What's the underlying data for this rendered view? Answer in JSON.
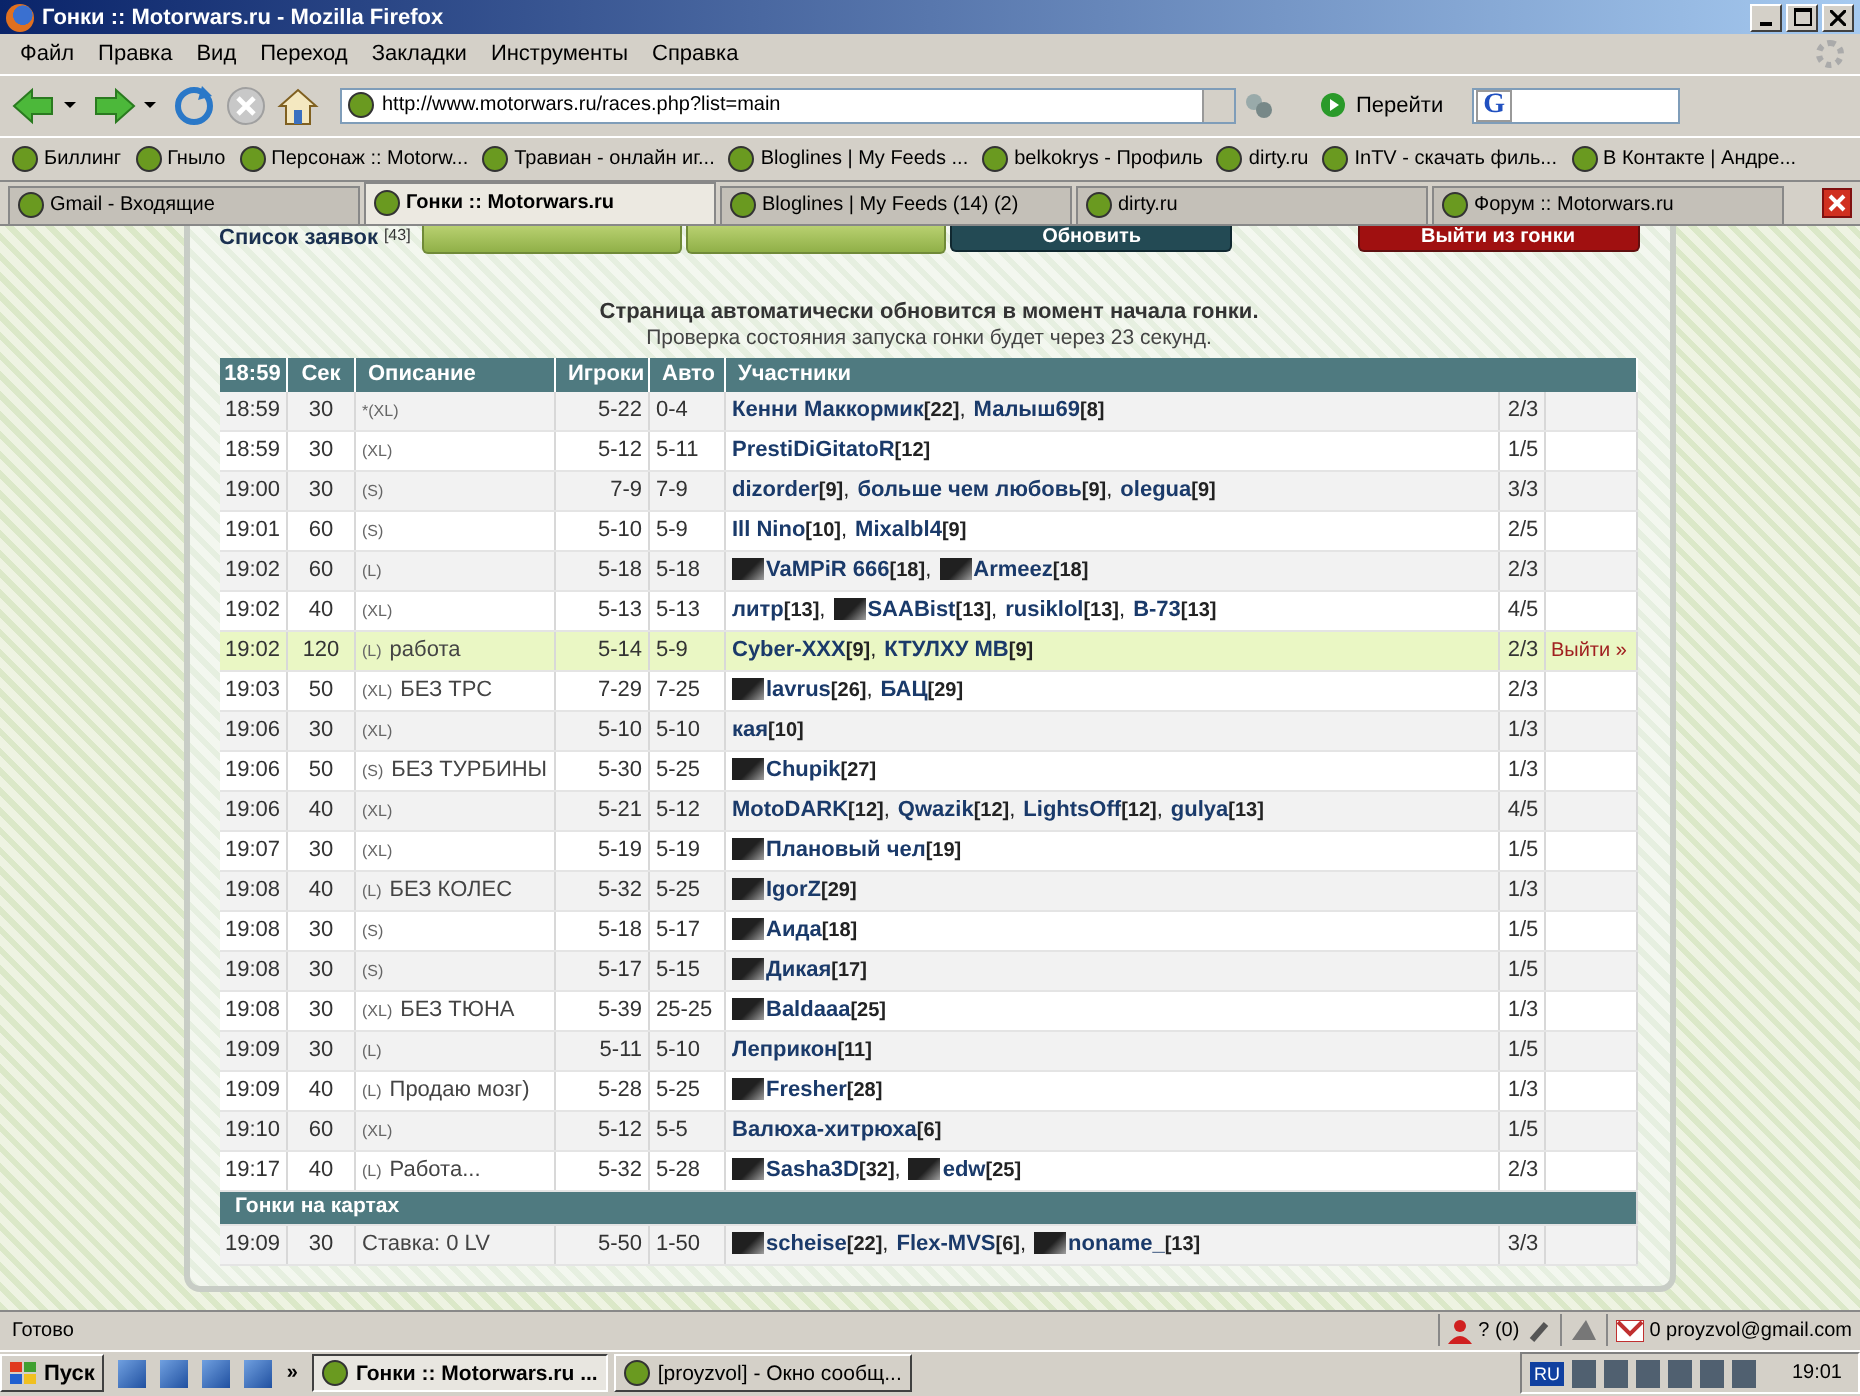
{
  "window": {
    "title": "Гонки :: Motorwars.ru - Mozilla Firefox"
  },
  "menu": [
    "Файл",
    "Правка",
    "Вид",
    "Переход",
    "Закладки",
    "Инструменты",
    "Справка"
  ],
  "address": {
    "value": "http://www.motorwars.ru/races.php?list=main"
  },
  "go_button": "Перейти",
  "search": {
    "engine_label": "G"
  },
  "bookmarks": [
    {
      "label": "Биллинг"
    },
    {
      "label": "Гныло"
    },
    {
      "label": "Персонаж :: Motorw..."
    },
    {
      "label": "Травиан - онлайн иг..."
    },
    {
      "label": "Bloglines | My Feeds ..."
    },
    {
      "label": "belkokrys - Профиль"
    },
    {
      "label": "dirty.ru"
    },
    {
      "label": "InTV - скачать филь..."
    },
    {
      "label": "В Контакте | Андре..."
    }
  ],
  "tabs": [
    {
      "label": "Gmail - Входящие",
      "selected": false
    },
    {
      "label": "Гонки :: Motorwars.ru",
      "selected": true
    },
    {
      "label": "Bloglines | My Feeds (14) (2)",
      "selected": false
    },
    {
      "label": "dirty.ru",
      "selected": false
    },
    {
      "label": "Форум :: Motorwars.ru",
      "selected": false
    }
  ],
  "page": {
    "list_title": "Список заявок",
    "list_count": "[43]",
    "refresh_button": "Обновить",
    "leave_button": "Выйти из гонки",
    "notice": "Страница автоматически обновится в момент начала гонки.",
    "notice_sub": "Проверка состояния запуска гонки будет через 23 секунд.",
    "table": {
      "columns": [
        "18:59",
        "Сек",
        "Описание",
        "Игроки",
        "Авто",
        "Участники"
      ],
      "rows": [
        {
          "time": "18:59",
          "sec": "30",
          "size": "*(XL)",
          "players": "5-22",
          "cars": "0-4",
          "participants": [
            {
              "name": "Кенни Маккормик",
              "rating": "[22]",
              "sep": ","
            },
            {
              "name": "Малыш69",
              "rating": "[8]"
            }
          ],
          "slots": "2/3",
          "selected": false
        },
        {
          "time": "18:59",
          "sec": "30",
          "size": "(XL)",
          "players": "5-12",
          "cars": "5-11",
          "participants": [
            {
              "name": "PrestiDiGitatoR",
              "rating": "[12]"
            }
          ],
          "slots": "1/5",
          "selected": false
        },
        {
          "time": "19:00",
          "sec": "30",
          "size": "(S)",
          "players": "7-9",
          "cars": "7-9",
          "participants": [
            {
              "name": "dizorder",
              "rating": "[9]",
              "sep": ","
            },
            {
              "name": "больше чем любовь",
              "rating": "[9]",
              "sep": ","
            },
            {
              "name": "olegua",
              "rating": "[9]"
            }
          ],
          "slots": "3/3",
          "selected": false
        },
        {
          "time": "19:01",
          "sec": "60",
          "size": "(S)",
          "players": "5-10",
          "cars": "5-9",
          "participants": [
            {
              "name": "Ill Nino",
              "rating": "[10]",
              "sep": ","
            },
            {
              "name": "Mixalbl4",
              "rating": "[9]"
            }
          ],
          "slots": "2/5",
          "selected": false
        },
        {
          "time": "19:02",
          "sec": "60",
          "size": "(L)",
          "players": "5-18",
          "cars": "5-18",
          "participants": [
            {
              "name": "VaMPiR 666",
              "rating": "[18]",
              "sep": ",",
              "emblem": true
            },
            {
              "name": "Armeez",
              "rating": "[18]",
              "emblem": true
            }
          ],
          "slots": "2/3",
          "selected": false
        },
        {
          "time": "19:02",
          "sec": "40",
          "size": "(XL)",
          "players": "5-13",
          "cars": "5-13",
          "participants": [
            {
              "name": "литр",
              "rating": "[13]",
              "sep": ","
            },
            {
              "name": "SAABist",
              "rating": "[13]",
              "sep": ",",
              "emblem": true
            },
            {
              "name": "rusiklol",
              "rating": "[13]",
              "sep": ","
            },
            {
              "name": "B-73",
              "rating": "[13]"
            }
          ],
          "slots": "4/5",
          "selected": false
        },
        {
          "time": "19:02",
          "sec": "120",
          "size": "(L)",
          "note": "работа",
          "players": "5-14",
          "cars": "5-9",
          "participants": [
            {
              "name": "Cyber-XXX",
              "rating": "[9]",
              "sep": ","
            },
            {
              "name": "КТУЛХУ МВ",
              "rating": "[9]"
            }
          ],
          "slots": "2/3",
          "action": "Выйти »",
          "selected": true
        },
        {
          "time": "19:03",
          "sec": "50",
          "size": "(XL)",
          "note": "БЕЗ ТРС",
          "players": "7-29",
          "cars": "7-25",
          "participants": [
            {
              "name": "lavrus",
              "rating": "[26]",
              "sep": ",",
              "emblem": true
            },
            {
              "name": "БАЦ",
              "rating": "[29]"
            }
          ],
          "slots": "2/3",
          "selected": false
        },
        {
          "time": "19:06",
          "sec": "30",
          "size": "(XL)",
          "players": "5-10",
          "cars": "5-10",
          "participants": [
            {
              "name": "кая",
              "rating": "[10]"
            }
          ],
          "slots": "1/3",
          "selected": false
        },
        {
          "time": "19:06",
          "sec": "50",
          "size": "(S)",
          "note": "БЕЗ ТУРБИНЫ",
          "players": "5-30",
          "cars": "5-25",
          "participants": [
            {
              "name": "Chupik",
              "rating": "[27]",
              "emblem": true
            }
          ],
          "slots": "1/3",
          "selected": false
        },
        {
          "time": "19:06",
          "sec": "40",
          "size": "(XL)",
          "players": "5-21",
          "cars": "5-12",
          "participants": [
            {
              "name": "MotoDARK",
              "rating": "[12]",
              "sep": ","
            },
            {
              "name": "Qwazik",
              "rating": "[12]",
              "sep": ","
            },
            {
              "name": "LightsOff",
              "rating": "[12]",
              "sep": ","
            },
            {
              "name": "gulya",
              "rating": "[13]"
            }
          ],
          "slots": "4/5",
          "selected": false
        },
        {
          "time": "19:07",
          "sec": "30",
          "size": "(XL)",
          "players": "5-19",
          "cars": "5-19",
          "participants": [
            {
              "name": "Плановый чел",
              "rating": "[19]",
              "emblem": true
            }
          ],
          "slots": "1/5",
          "selected": false
        },
        {
          "time": "19:08",
          "sec": "40",
          "size": "(L)",
          "note": "БЕЗ КОЛЕС",
          "players": "5-32",
          "cars": "5-25",
          "participants": [
            {
              "name": "IgorZ",
              "rating": "[29]",
              "emblem": true
            }
          ],
          "slots": "1/3",
          "selected": false
        },
        {
          "time": "19:08",
          "sec": "30",
          "size": "(S)",
          "players": "5-18",
          "cars": "5-17",
          "participants": [
            {
              "name": "Аида",
              "rating": "[18]",
              "emblem": true
            }
          ],
          "slots": "1/5",
          "selected": false
        },
        {
          "time": "19:08",
          "sec": "30",
          "size": "(S)",
          "players": "5-17",
          "cars": "5-15",
          "participants": [
            {
              "name": "Дикая",
              "rating": "[17]",
              "emblem": true
            }
          ],
          "slots": "1/5",
          "selected": false
        },
        {
          "time": "19:08",
          "sec": "30",
          "size": "(XL)",
          "note": "БЕЗ ТЮНА",
          "players": "5-39",
          "cars": "25-25",
          "participants": [
            {
              "name": "Baldaaa",
              "rating": "[25]",
              "emblem": true
            }
          ],
          "slots": "1/3",
          "selected": false
        },
        {
          "time": "19:09",
          "sec": "30",
          "size": "(L)",
          "players": "5-11",
          "cars": "5-10",
          "participants": [
            {
              "name": "Леприкон",
              "rating": "[11]"
            }
          ],
          "slots": "1/5",
          "selected": false
        },
        {
          "time": "19:09",
          "sec": "40",
          "size": "(L)",
          "note": "Продаю мозг)",
          "players": "5-28",
          "cars": "5-25",
          "participants": [
            {
              "name": "Fresher",
              "rating": "[28]",
              "emblem": true
            }
          ],
          "slots": "1/3",
          "selected": false
        },
        {
          "time": "19:10",
          "sec": "60",
          "size": "(XL)",
          "players": "5-12",
          "cars": "5-5",
          "participants": [
            {
              "name": "Валюха-хитрюха",
              "rating": "[6]"
            }
          ],
          "slots": "1/5",
          "selected": false
        },
        {
          "time": "19:17",
          "sec": "40",
          "size": "(L)",
          "note": "Работа...",
          "players": "5-32",
          "cars": "5-28",
          "participants": [
            {
              "name": "Sasha3D",
              "rating": "[32]",
              "sep": ",",
              "emblem": true
            },
            {
              "name": "edw",
              "rating": "[25]",
              "emblem": true
            }
          ],
          "slots": "2/3",
          "selected": false
        }
      ],
      "section": "Гонки на картах",
      "section_rows": [
        {
          "time": "19:09",
          "sec": "30",
          "note": "Ставка: 0 LV",
          "players": "5-50",
          "cars": "1-50",
          "participants": [
            {
              "name": "scheise",
              "rating": "[22]",
              "sep": ",",
              "emblem": true
            },
            {
              "name": "Flex-MVS",
              "rating": "[6]",
              "sep": ","
            },
            {
              "name": "noname_",
              "rating": "[13]",
              "emblem": true
            }
          ],
          "slots": "3/3",
          "selected": false
        }
      ]
    }
  },
  "status_bar": {
    "text": "Готово",
    "messages": "? (0)",
    "mail": "0 proyzvol@gmail.com"
  },
  "taskbar": {
    "start": "Пуск",
    "more": "»",
    "lang": "RU",
    "time": "19:01",
    "windows": [
      {
        "label": "Гонки :: Motorwars.ru ...",
        "selected": true
      },
      {
        "label": "[proyzvol] - Окно сообщ...",
        "selected": false
      }
    ]
  }
}
